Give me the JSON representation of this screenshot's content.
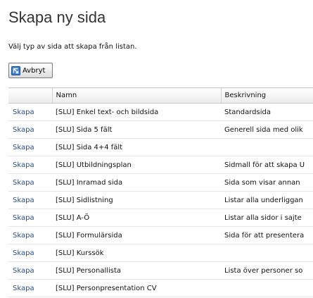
{
  "page": {
    "title": "Skapa ny sida",
    "instructions": "Välj typ av sida att skapa från listan."
  },
  "toolbar": {
    "cancel_label": "Avbryt",
    "cancel_icon": "cancel-icon"
  },
  "table": {
    "headers": {
      "action": "",
      "name": "Namn",
      "description": "Beskrivning"
    },
    "rows": [
      {
        "action": "Skapa",
        "name": "[SLU] Enkel text- och bildsida",
        "description": "Standardsida"
      },
      {
        "action": "Skapa",
        "name": "[SLU] Sida 5 fält",
        "description": "Generell sida med olik"
      },
      {
        "action": "Skapa",
        "name": "[SLU] Sida 4+4 fält",
        "description": ""
      },
      {
        "action": "Skapa",
        "name": "[SLU] Utbildningsplan",
        "description": "Sidmall för att skapa U"
      },
      {
        "action": "Skapa",
        "name": "[SLU] Inramad sida",
        "description": "Sida som visar annan"
      },
      {
        "action": "Skapa",
        "name": "[SLU] Sidlistning",
        "description": "Listar alla underliggan"
      },
      {
        "action": "Skapa",
        "name": "[SLU] A-Ö",
        "description": "Listar alla sidor i sajte"
      },
      {
        "action": "Skapa",
        "name": "[SLU] Formulärsida",
        "description": "Sida för att presentera"
      },
      {
        "action": "Skapa",
        "name": "[SLU] Kurssök",
        "description": ""
      },
      {
        "action": "Skapa",
        "name": "[SLU] Personallista",
        "description": "Lista över personer so"
      },
      {
        "action": "Skapa",
        "name": "[SLU] Personpresentation CV",
        "description": ""
      }
    ]
  },
  "colors": {
    "link": "#1f4e8c",
    "title": "#333333"
  }
}
